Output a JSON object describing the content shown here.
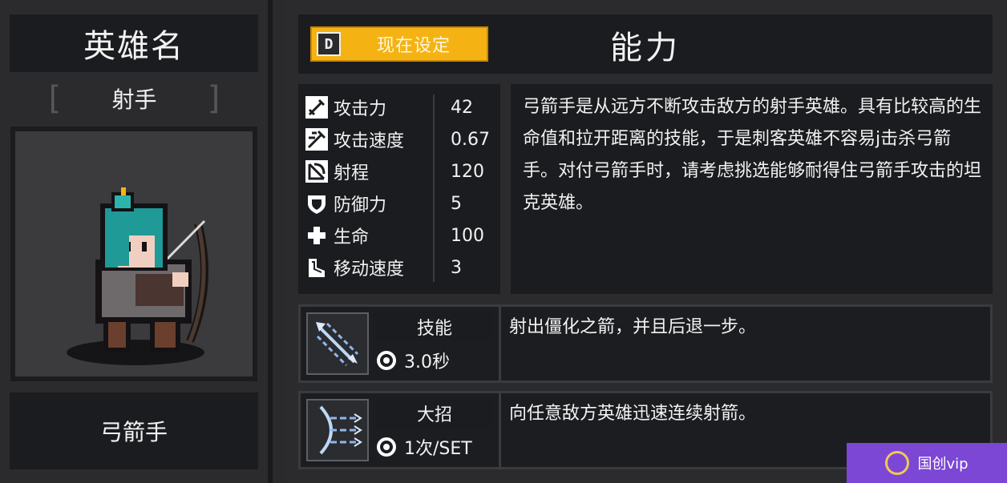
{
  "left_panel": {
    "hero_name_title": "英雄名",
    "role": "射手",
    "bracket_open": "[",
    "bracket_close": "]",
    "hero_class": "弓箭手"
  },
  "header": {
    "set_button_key": "D",
    "set_button_label": "现在设定",
    "ability_title": "能力"
  },
  "stats": [
    {
      "icon": "sword-icon",
      "label": "攻击力",
      "value": "42"
    },
    {
      "icon": "attack-speed-icon",
      "label": "攻击速度",
      "value": "0.67"
    },
    {
      "icon": "range-icon",
      "label": "射程",
      "value": "120"
    },
    {
      "icon": "shield-icon",
      "label": "防御力",
      "value": "5"
    },
    {
      "icon": "health-cross-icon",
      "label": "生命",
      "value": "100"
    },
    {
      "icon": "boot-icon",
      "label": "移动速度",
      "value": "3"
    }
  ],
  "description": "弓箭手是从远方不断攻击敌方的射手英雄。具有比较高的生命值和拉开距离的技能，于是刺客英雄不容易j击杀弓箭手。对付弓箭手时，请考虑挑选能够耐得住弓箭手攻击的坦克英雄。",
  "skill": {
    "title": "技能",
    "cooldown": "3.0秒",
    "description": "射出僵化之箭，并且后退一步。"
  },
  "ultimate": {
    "title": "大招",
    "uses": "1次/SET",
    "description": "向任意敌方英雄迅速连续射箭。"
  },
  "watermark": {
    "text": "国创vip"
  },
  "colors": {
    "accent_yellow": "#f5b313",
    "panel_dark": "#1b1c1f",
    "background": "#2b2b2e",
    "hair_teal": "#1f9a96"
  }
}
